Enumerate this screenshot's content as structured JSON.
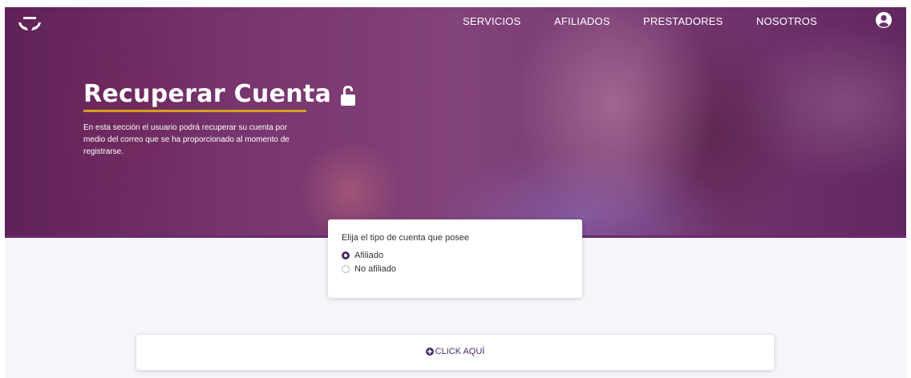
{
  "header": {
    "logo_icon": "hands-logo-icon",
    "nav": [
      {
        "label": "SERVICIOS"
      },
      {
        "label": "AFILIADOS"
      },
      {
        "label": "PRESTADORES"
      },
      {
        "label": "NOSOTROS"
      }
    ],
    "user_icon": "user-circle-icon"
  },
  "hero": {
    "title": "Recuperar Cuenta",
    "title_icon": "unlock-icon",
    "description": "En esta sección el usuario podrá recuperar su cuenta por medio del correo que se ha proporcionado al momento de registrarse."
  },
  "account_card": {
    "question": "Elija el tipo de cuenta que posee",
    "options": [
      {
        "label": "Afiliado",
        "checked": true
      },
      {
        "label": "No afiliado",
        "checked": false
      }
    ]
  },
  "action": {
    "icon": "plus-circle-icon",
    "label": "CLICK AQUÍ"
  },
  "colors": {
    "accent_purple": "#4a2a6a",
    "underline_gold": "#d6a019",
    "page_bg": "#f6f5f9"
  }
}
